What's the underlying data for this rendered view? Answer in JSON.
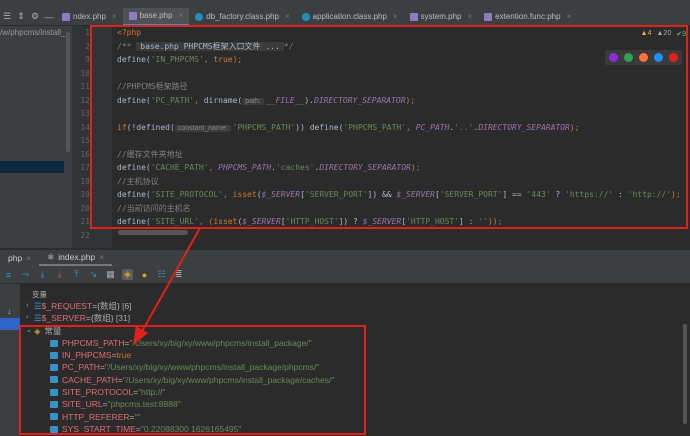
{
  "project_path": "/w/phpcms/install_",
  "tabs": [
    {
      "label": "ndex.php",
      "icon": "php-file-icon"
    },
    {
      "label": "base.php",
      "icon": "php-file-icon",
      "active": true
    },
    {
      "label": "db_factory.class.php",
      "icon": "php-class-icon"
    },
    {
      "label": "application.class.php",
      "icon": "php-class-icon"
    },
    {
      "label": "system.php",
      "icon": "php-file-icon"
    },
    {
      "label": "extention.func.php",
      "icon": "php-file-icon"
    }
  ],
  "line_numbers": [
    "1",
    "2",
    "9",
    "10",
    "11",
    "12",
    "13",
    "14",
    "15",
    "16",
    "17",
    "18",
    "19",
    "20",
    "21",
    "22"
  ],
  "code": [
    [
      {
        "t": "<?php",
        "k": "kw"
      }
    ],
    [
      {
        "t": "/** ",
        "k": "cm"
      },
      {
        "t": "base.php PHPCMS框架入口文件 ...",
        "k": "fold"
      },
      {
        "t": "*/",
        "k": "cm"
      }
    ],
    [
      {
        "t": "define(",
        "k": "fn"
      },
      {
        "t": "'IN_PHPCMS'",
        "k": "str"
      },
      {
        "t": ", ",
        "k": "kw"
      },
      {
        "t": "true",
        "k": "kw"
      },
      {
        "t": ");",
        "k": "kw"
      }
    ],
    [],
    [
      {
        "t": "//PHPCMS框架路径",
        "k": "cm"
      }
    ],
    [
      {
        "t": "define(",
        "k": "fn"
      },
      {
        "t": "'PC_PATH'",
        "k": "str"
      },
      {
        "t": ", ",
        "k": "kw"
      },
      {
        "t": "dirname(",
        "k": "fn"
      },
      {
        "t": "path:",
        "k": "hint"
      },
      {
        "t": "__FILE__",
        "k": "const"
      },
      {
        "t": ").",
        "k": "tx"
      },
      {
        "t": "DIRECTORY_SEPARATOR",
        "k": "const"
      },
      {
        "t": ");",
        "k": "kw"
      }
    ],
    [],
    [
      {
        "t": "if",
        "k": "kw"
      },
      {
        "t": "(!defined(",
        "k": "tx"
      },
      {
        "t": "constant_name:",
        "k": "hint"
      },
      {
        "t": "'PHPCMS_PATH'",
        "k": "str"
      },
      {
        "t": ")) define(",
        "k": "tx"
      },
      {
        "t": "'PHPCMS_PATH'",
        "k": "str"
      },
      {
        "t": ", ",
        "k": "kw"
      },
      {
        "t": "PC_PATH",
        "k": "const"
      },
      {
        "t": ".",
        "k": "tx"
      },
      {
        "t": "'..'",
        "k": "str"
      },
      {
        "t": ".",
        "k": "tx"
      },
      {
        "t": "DIRECTORY_SEPARATOR",
        "k": "const"
      },
      {
        "t": ");",
        "k": "kw"
      }
    ],
    [],
    [
      {
        "t": "//缓存文件夹地址",
        "k": "cm"
      }
    ],
    [
      {
        "t": "define(",
        "k": "fn"
      },
      {
        "t": "'CACHE_PATH'",
        "k": "str"
      },
      {
        "t": ", ",
        "k": "kw"
      },
      {
        "t": "PHPCMS_PATH",
        "k": "const"
      },
      {
        "t": ".",
        "k": "tx"
      },
      {
        "t": "'caches'",
        "k": "str"
      },
      {
        "t": ".",
        "k": "tx"
      },
      {
        "t": "DIRECTORY_SEPARATOR",
        "k": "const"
      },
      {
        "t": ");",
        "k": "kw"
      }
    ],
    [
      {
        "t": "//主机协议",
        "k": "cm"
      }
    ],
    [
      {
        "t": "define(",
        "k": "fn"
      },
      {
        "t": "'SITE_PROTOCOL'",
        "k": "str"
      },
      {
        "t": ", ",
        "k": "kw"
      },
      {
        "t": "isset",
        "k": "kw"
      },
      {
        "t": "(",
        "k": "tx"
      },
      {
        "t": "$_SERVER",
        "k": "const"
      },
      {
        "t": "[",
        "k": "tx"
      },
      {
        "t": "'SERVER_PORT'",
        "k": "str"
      },
      {
        "t": "]) && ",
        "k": "tx"
      },
      {
        "t": "$_SERVER",
        "k": "const"
      },
      {
        "t": "[",
        "k": "tx"
      },
      {
        "t": "'SERVER_PORT'",
        "k": "str"
      },
      {
        "t": "] == ",
        "k": "tx"
      },
      {
        "t": "'443'",
        "k": "str"
      },
      {
        "t": " ? ",
        "k": "tx"
      },
      {
        "t": "'https://'",
        "k": "str"
      },
      {
        "t": " : ",
        "k": "tx"
      },
      {
        "t": "'http://'",
        "k": "str"
      },
      {
        "t": ");",
        "k": "kw"
      }
    ],
    [
      {
        "t": "//当前访问的主机名",
        "k": "cm"
      }
    ],
    [
      {
        "t": "define(",
        "k": "fn"
      },
      {
        "t": "'SITE_URL'",
        "k": "str"
      },
      {
        "t": ", (",
        "k": "kw"
      },
      {
        "t": "isset",
        "k": "kw"
      },
      {
        "t": "(",
        "k": "tx"
      },
      {
        "t": "$_SERVER",
        "k": "const"
      },
      {
        "t": "[",
        "k": "tx"
      },
      {
        "t": "'HTTP_HOST'",
        "k": "str"
      },
      {
        "t": "]) ? ",
        "k": "tx"
      },
      {
        "t": "$_SERVER",
        "k": "const"
      },
      {
        "t": "[",
        "k": "tx"
      },
      {
        "t": "'HTTP_HOST'",
        "k": "str"
      },
      {
        "t": "] : ",
        "k": "tx"
      },
      {
        "t": "''",
        "k": "str"
      },
      {
        "t": "));",
        "k": "kw"
      }
    ],
    []
  ],
  "inspections": {
    "warnings": "4",
    "weak_warnings": "20",
    "ok": "9"
  },
  "browsers": [
    {
      "name": "phpstorm",
      "color": "#8a2be2"
    },
    {
      "name": "chrome",
      "color": "#2ea44f"
    },
    {
      "name": "firefox",
      "color": "#ff7139"
    },
    {
      "name": "safari",
      "color": "#1e90ff"
    },
    {
      "name": "opera",
      "color": "#e0201b"
    }
  ],
  "debug_tabs": [
    {
      "label": "php"
    },
    {
      "label": "index.php",
      "active": true
    }
  ],
  "variables": {
    "header": "变量",
    "rows": [
      {
        "name": "$_REQUEST",
        "value": "{数组} [6]"
      },
      {
        "name": "$_SERVER",
        "value": "{数组} [31]"
      }
    ],
    "constants_label": "常量",
    "constants": [
      {
        "name": "PHPCMS_PATH",
        "value": "\"/Users/xy/big/xy/www/phpcms/install_package/\"",
        "type": "str"
      },
      {
        "name": "IN_PHPCMS",
        "value": "true",
        "type": "bool"
      },
      {
        "name": "PC_PATH",
        "value": "\"/Users/xy/big/xy/www/phpcms/install_package/phpcms/\"",
        "type": "str"
      },
      {
        "name": "CACHE_PATH",
        "value": "\"/Users/xy/big/xy/www/phpcms/install_package/caches/\"",
        "type": "str"
      },
      {
        "name": "SITE_PROTOCOL",
        "value": "\"http://\"",
        "type": "str"
      },
      {
        "name": "SITE_URL",
        "value": "\"phpcms.test:8888\"",
        "type": "str"
      },
      {
        "name": "HTTP_REFERER",
        "value": "\"\"",
        "type": "str"
      },
      {
        "name": "SYS_START_TIME",
        "value": "\"0.22088300 1626165495\"",
        "type": "str"
      }
    ]
  },
  "annotation_color": "#e0201b"
}
